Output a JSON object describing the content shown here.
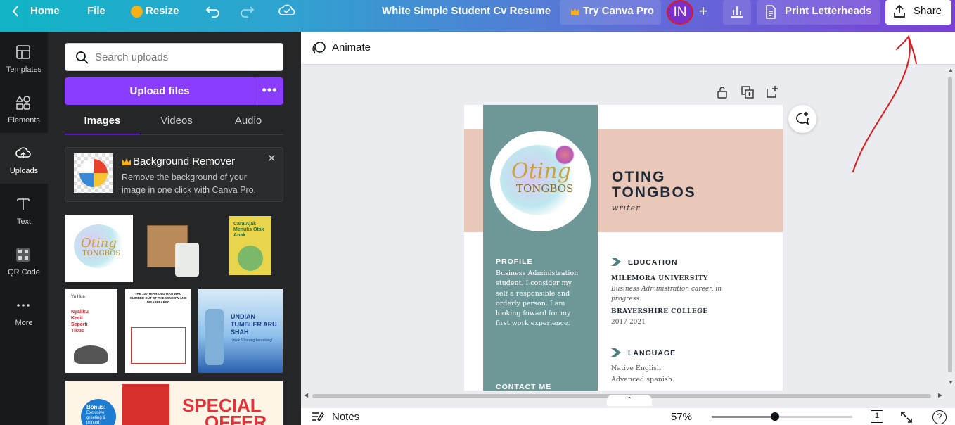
{
  "topbar": {
    "home": "Home",
    "file": "File",
    "resize": "Resize",
    "title": "White Simple Student Cv Resume",
    "try_pro": "Try Canva Pro",
    "avatar": "IN",
    "print": "Print Letterheads",
    "share": "Share"
  },
  "sidebar": {
    "items": [
      {
        "label": "Templates",
        "icon": "templates-icon"
      },
      {
        "label": "Elements",
        "icon": "elements-icon"
      },
      {
        "label": "Uploads",
        "icon": "uploads-icon"
      },
      {
        "label": "Text",
        "icon": "text-icon"
      },
      {
        "label": "QR Code",
        "icon": "qr-code-icon"
      },
      {
        "label": "More",
        "icon": "more-icon"
      }
    ]
  },
  "panel": {
    "search_placeholder": "Search uploads",
    "upload_label": "Upload files",
    "tabs": [
      "Images",
      "Videos",
      "Audio"
    ],
    "bg_remover_title": "Background Remover",
    "bg_remover_desc": "Remove the background of your image in one click with Canva Pro.",
    "thumbs": {
      "logo_line1": "Oting",
      "logo_line2": "TONGBOS",
      "book1_title": "Cara Ajak Menulis Otak Anak",
      "book2_author": "Yu Hua",
      "book2_title": "Nyaliku Kecil Seperti Tikus",
      "letter_title": "THE 100-YEAR-OLD MAN WHO CLIMBED OUT OF THE WINDOW AND DISAPPEARED",
      "promo_title": "UNDIAN TUMBLER ARU SHAH",
      "promo_sub": "Untuk 10 orang beruntung!",
      "banner_bonus": "Bonus!",
      "banner_bonus_sub": "Exclusive greeting & printed",
      "banner_special": "SPECIAL",
      "banner_offer": "OFFER"
    }
  },
  "canvas": {
    "animate": "Animate",
    "resume": {
      "name_line1": "OTING",
      "name_line2": "TONGBOS",
      "role": "writer",
      "logo_line1": "Oting",
      "logo_line2": "TONGBOS",
      "profile_heading": "PROFILE",
      "profile_text": "Business Administration student. I consider my self a responsible and orderly person. I am looking foward for my first work experience.",
      "contact_heading": "CONTACT ME",
      "education_heading": "EDUCATION",
      "edu1_school": "MILEMORA UNIVERSITY",
      "edu1_desc": "Business Administration career, in progress.",
      "edu2_school": "BRAYERSHIRE COLLEGE",
      "edu2_years": "2017-2021",
      "language_heading": "LANGUAGE",
      "lang1": "Native English.",
      "lang2": "Advanced spanish."
    }
  },
  "bottombar": {
    "notes": "Notes",
    "zoom": "57%",
    "zoom_fraction": 0.45,
    "page_count": "1"
  },
  "colors": {
    "brand": "#8b3dff",
    "teal_column": "#6e9897",
    "peach_band": "#e9c7b9",
    "annotation": "#e0191c"
  }
}
